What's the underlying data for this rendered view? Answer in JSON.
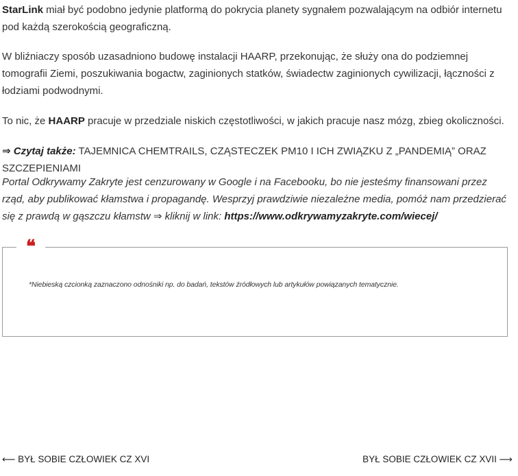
{
  "article": {
    "p1_bold": "StarLink",
    "p1_rest": " miał być podobno jedynie platformą do pokrycia planety sygnałem pozwalającym na odbiór internetu pod każdą szerokością geograficzną.",
    "p2": "W bliźniaczy sposób uzasadniono budowę instalacji HAARP, przekonując, że służy ona do podziemnej tomografii Ziemi, poszukiwania bogactw, zaginionych statków, świadectw zaginionych cywilizacji, łączności z łodziami podwodnymi.",
    "p3_pre": "To nic, że ",
    "p3_bold": "HAARP",
    "p3_post": " pracuje w przedziale niskich częstotliwości, w jakich pracuje nasz mózg, zbieg okoliczności.",
    "read_also_prefix": "⇒ Czytaj także:",
    "read_also_link": " TAJEMNICA CHEMTRAILS, CZĄSTECZEK PM10 I ICH ZWIĄZKU Z „PANDEMIĄ” ORAZ SZCZEPIENIAMI",
    "support_text": "Portal Odkrywamy Zakryte jest cenzurowany w Google i na Facebooku, bo nie jesteśmy finansowani przez rząd, aby publikować kłamstwa i propagandę. Wesprzyj prawdziwie niezależne media, pomóż nam przedzierać się z prawdą w gąszczu kłamstw ⇒ kliknij w link: ",
    "support_link": "https://www.odkrywamyzakryte.com/wiecej/"
  },
  "quote_box": {
    "quote_glyph": "❝",
    "note": "*Niebieską czcionką zaznaczono odnośniki np. do badań, tekstów źródłowych lub artykułów powiązanych tematycznie."
  },
  "post_nav": {
    "prev_arrow": "⟵",
    "prev_label": " BYŁ SOBIE CZŁOWIEK CZ XVI",
    "next_label": "BYŁ SOBIE CZŁOWIEK CZ XVII ",
    "next_arrow": "⟶"
  },
  "colors": {
    "quote_accent": "#cc1f1f",
    "text": "#333333",
    "border": "#9a9a9a"
  }
}
